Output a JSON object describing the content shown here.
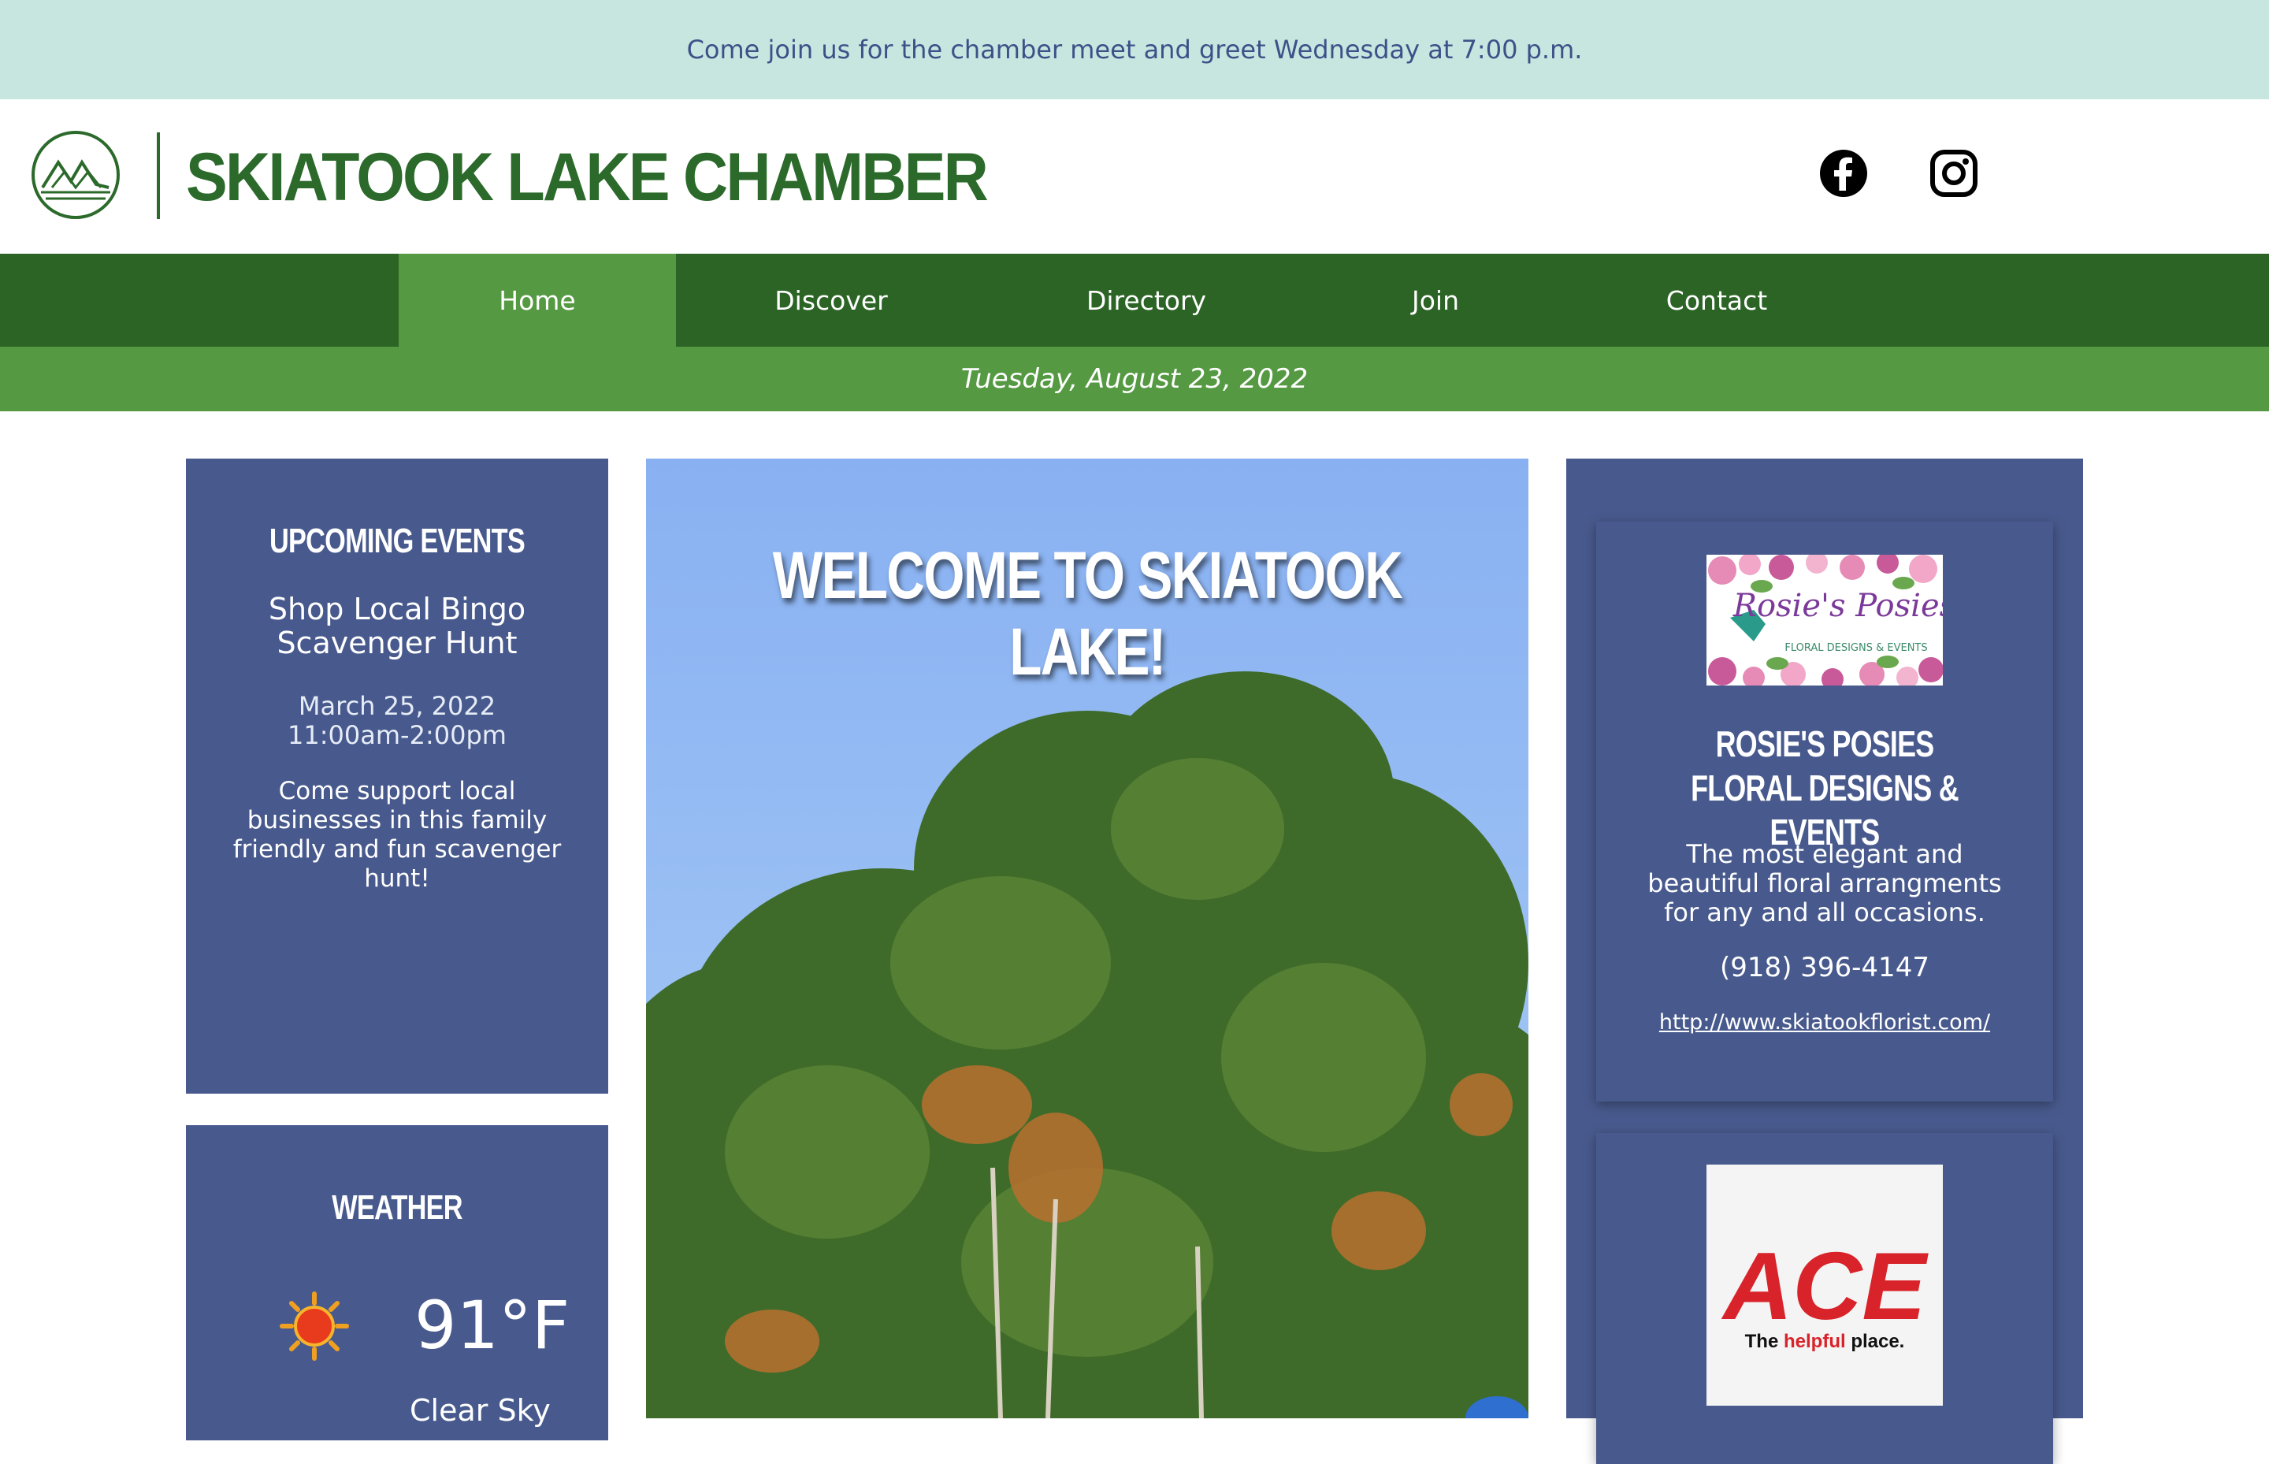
{
  "announcement": {
    "text": "Come join us for the chamber meet and greet Wednesday at 7:00 p.m."
  },
  "header": {
    "site_title": "SKIATOOK LAKE CHAMBER",
    "social": [
      {
        "icon": "facebook-icon"
      },
      {
        "icon": "instagram-icon"
      }
    ]
  },
  "nav": {
    "items": [
      {
        "label": "Home",
        "active": true
      },
      {
        "label": "Discover",
        "active": false
      },
      {
        "label": "Directory",
        "active": false
      },
      {
        "label": "Join",
        "active": false
      },
      {
        "label": "Contact",
        "active": false
      }
    ]
  },
  "date_bar": {
    "text": "Tuesday, August 23, 2022"
  },
  "events": {
    "title": "UPCOMING EVENTS",
    "event": {
      "name": "Shop Local Bingo Scavenger Hunt",
      "date": "March 25, 2022",
      "time": "11:00am-2:00pm",
      "description": "Come support local businesses in this family friendly and fun scavenger hunt!"
    }
  },
  "weather": {
    "title": "WEATHER",
    "icon": "sun-icon",
    "temperature": "91°F",
    "condition": "Clear Sky"
  },
  "hero": {
    "title": "WELCOME TO SKIATOOK LAKE!"
  },
  "ads": [
    {
      "logo_text": "Rosie's Posies",
      "logo_subtext": "FLORAL DESIGNS & EVENTS",
      "name": "ROSIE'S POSIES FLORAL DESIGNS & EVENTS",
      "description": "The most elegant and beautiful floral arrangments for any and all occasions.",
      "phone": "(918) 396-4147",
      "url": "http://www.skiatookflorist.com/"
    },
    {
      "logo_text": "ACE",
      "logo_tagline_1": "The",
      "logo_tagline_2": "helpful",
      "logo_tagline_3": "place."
    }
  ],
  "colors": {
    "announcement_bg": "#c7e6df",
    "brand_green": "#2b6a2b",
    "nav_bg": "#2b6425",
    "nav_active": "#559942",
    "panel_blue": "#485a8d"
  }
}
